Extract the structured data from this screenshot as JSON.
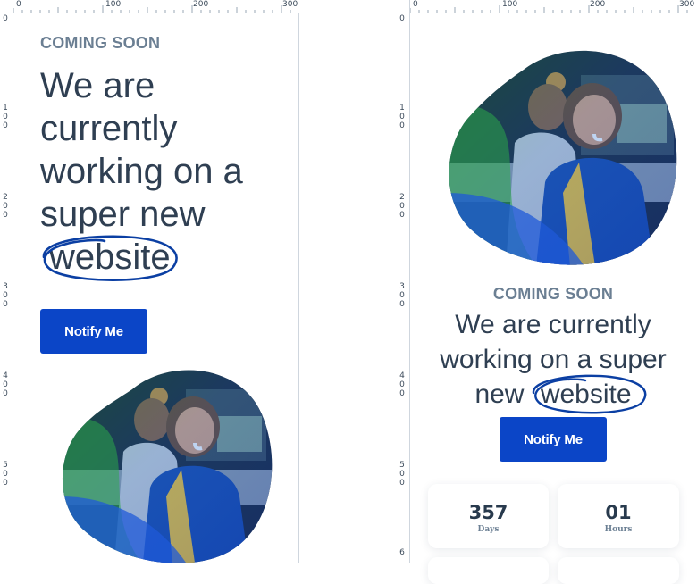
{
  "left_preview": {
    "ruler_top": [
      "0",
      "100",
      "200",
      "300"
    ],
    "ruler_left": [
      "0",
      "100",
      "200",
      "300",
      "400",
      "500"
    ],
    "coming_soon": "COMING SOON",
    "headline_lines": [
      "We are",
      "currently",
      "working on a",
      "super new"
    ],
    "highlight_word": "website",
    "notify_label": "Notify Me"
  },
  "right_preview": {
    "ruler_top": [
      "0",
      "100",
      "200",
      "300"
    ],
    "ruler_left": [
      "0",
      "100",
      "200",
      "300",
      "400",
      "500",
      "6"
    ],
    "coming_soon": "COMING SOON",
    "headline_line1": "We are currently",
    "headline_line2": "working on a super",
    "headline_line3_prefix": "new",
    "highlight_word": "website",
    "notify_label": "Notify Me",
    "counters": [
      {
        "value": "357",
        "label": "Days"
      },
      {
        "value": "01",
        "label": "Hours"
      }
    ]
  },
  "colors": {
    "accent": "#0b45c7",
    "heading": "#2f3f52",
    "eyebrow": "#6b7f93",
    "highlight_ellipse": "#0b3fa3"
  },
  "icons": {
    "hero_image": "team-at-desk-blob"
  }
}
